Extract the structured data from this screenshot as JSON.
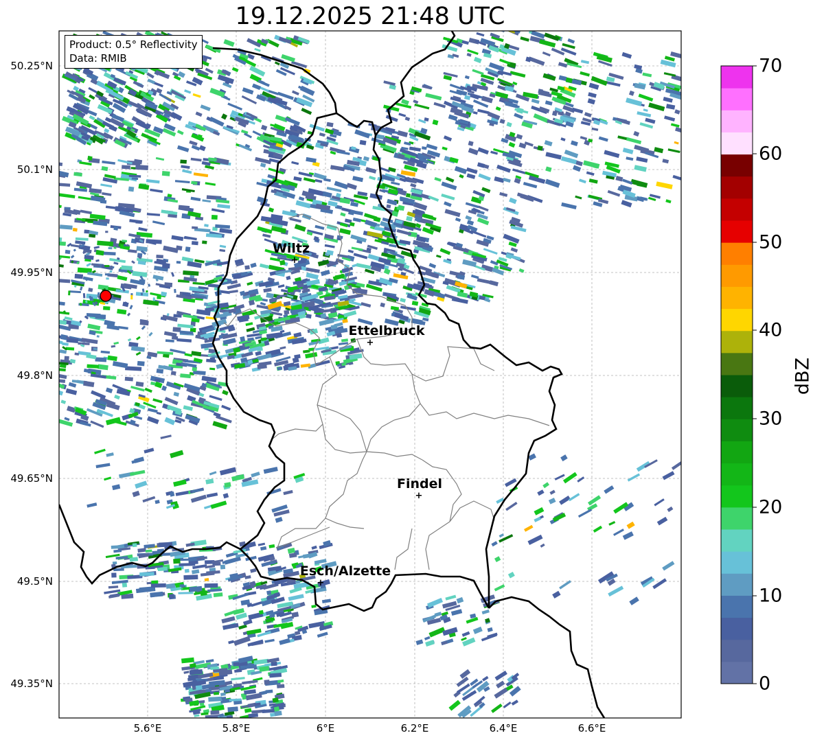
{
  "title": "19.12.2025 21:48 UTC",
  "info": {
    "product": "Product: 0.5° Reflectivity",
    "source": "Data: RMIB"
  },
  "y_ticks": [
    "50.25°N",
    "50.1°N",
    "49.95°N",
    "49.8°N",
    "49.65°N",
    "49.5°N",
    "49.35°N"
  ],
  "x_ticks": [
    "5.6°E",
    "5.8°E",
    "6°E",
    "6.2°E",
    "6.4°E",
    "6.6°E"
  ],
  "cities": [
    {
      "name": "Wiltz"
    },
    {
      "name": "Ettelbruck"
    },
    {
      "name": "Findel"
    },
    {
      "name": "Esch/Alzette"
    }
  ],
  "colorbar": {
    "label": "dBZ",
    "ticks": [
      "0",
      "10",
      "20",
      "30",
      "40",
      "50",
      "60",
      "70"
    ],
    "range": [
      0,
      70
    ],
    "colors": [
      "#6272a6",
      "#57689e",
      "#4960a0",
      "#4a74ad",
      "#5f9cc2",
      "#67c1d8",
      "#62d3c0",
      "#3ed46b",
      "#13c61c",
      "#13b617",
      "#12a612",
      "#0f8c10",
      "#0b770d",
      "#0a5c0a",
      "#497712",
      "#adb20a",
      "#ffd600",
      "#ffb300",
      "#ff9a00",
      "#ff7f00",
      "#e60000",
      "#c40000",
      "#a30000",
      "#780000",
      "#ffe0ff",
      "#ffb3ff",
      "#ff70ff",
      "#ee33ee"
    ]
  },
  "legend_colors": {
    "border": "#000000",
    "admin": "#808080",
    "radar_site": "#ff0000"
  }
}
